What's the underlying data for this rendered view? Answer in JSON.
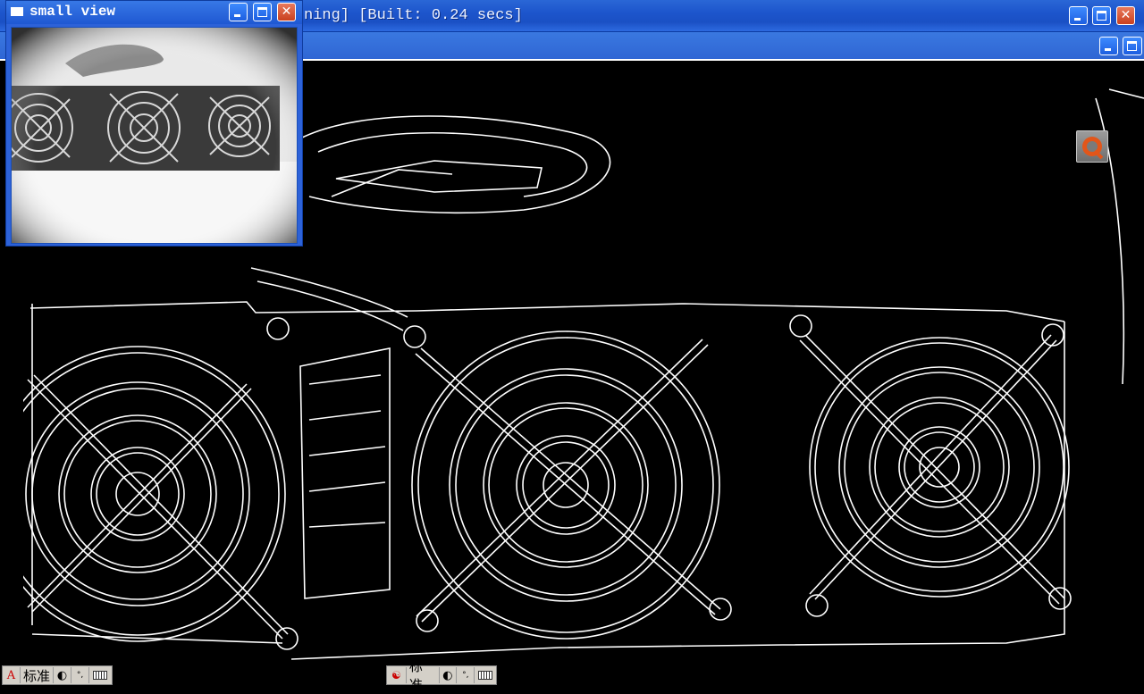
{
  "main_window": {
    "title": "ning] [Built: 0.24 secs]"
  },
  "small_view": {
    "title": "small view"
  },
  "ime_left": {
    "mode_icon": "A",
    "label": "标准",
    "moon_icon": "half-moon-icon",
    "punct_icon": "°,",
    "keyboard_icon": "keyboard-icon"
  },
  "ime_right": {
    "mode_icon": "pinyin-logo-icon",
    "label": "标准",
    "moon_icon": "half-moon-icon",
    "punct_icon": "°,",
    "keyboard_icon": "keyboard-icon"
  },
  "colors": {
    "titlebar": "#1d55cc",
    "canvas_bg": "#000000",
    "edge_lines": "#ffffff",
    "close_button": "#c9401f"
  }
}
